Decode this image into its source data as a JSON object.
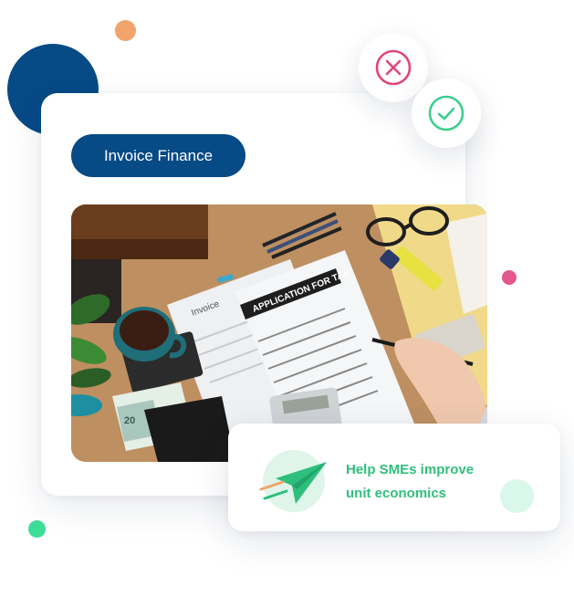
{
  "badge": {
    "label": "Invoice Finance"
  },
  "actions": {
    "reject_icon": "close-icon",
    "approve_icon": "check-icon"
  },
  "photo": {
    "subject": "invoice-tax-form-photo",
    "invoice_label": "Invoice",
    "form_title": "APPLICATION FOR TAX",
    "banknote_value": "20"
  },
  "feature": {
    "icon": "paper-plane-icon",
    "line1": "Help SMEs improve",
    "line2": "unit economics"
  },
  "colors": {
    "navy": "#064a86",
    "green": "#2fbf7d",
    "reject": "#e0467c",
    "approve": "#3ccf8e",
    "orange": "#f3a36c",
    "pink": "#e3578c",
    "mint": "#d9f7ea"
  }
}
